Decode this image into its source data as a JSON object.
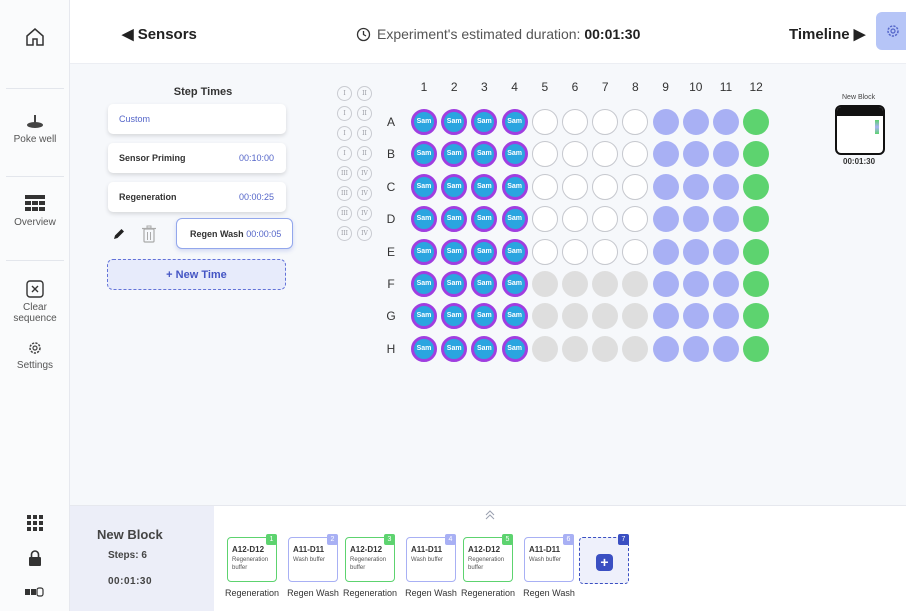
{
  "sidebar": {
    "poke_well": "Poke well",
    "overview": "Overview",
    "clear_sequence": "Clear sequence",
    "settings": "Settings"
  },
  "topbar": {
    "back_label": "◀ Sensors",
    "duration_label": "Experiment's estimated duration: ",
    "duration_value": "00:01:30",
    "next_label": "Timeline ▶"
  },
  "step_times": {
    "title": "Step Times",
    "items": [
      {
        "label": "Custom",
        "time": ""
      },
      {
        "label": "Sensor Priming",
        "time": "00:10:00"
      },
      {
        "label": "Regeneration",
        "time": "00:00:25"
      }
    ],
    "selected": {
      "label": "Regen Wash",
      "time": "00:00:05"
    },
    "new_time_label": "+ New Time"
  },
  "roman_rows": [
    [
      "I",
      "II"
    ],
    [
      "I",
      "II"
    ],
    [
      "I",
      "II"
    ],
    [
      "I",
      "II"
    ],
    [
      "III",
      "IV"
    ],
    [
      "III",
      "IV"
    ],
    [
      "III",
      "IV"
    ],
    [
      "III",
      "IV"
    ]
  ],
  "plate": {
    "columns": [
      "1",
      "2",
      "3",
      "4",
      "5",
      "6",
      "7",
      "8",
      "9",
      "10",
      "11",
      "12"
    ],
    "rows": [
      "A",
      "B",
      "C",
      "D",
      "E",
      "F",
      "G",
      "H"
    ],
    "sample_label": "Sam",
    "colors": {
      "sample": "#2aa5e0",
      "sample_ring": "#a03ee0",
      "lavender": "#a8b0f4",
      "green": "#5dd36f",
      "grey": "#dedede"
    }
  },
  "block_preview": {
    "label": "New Block",
    "time": "00:01:30"
  },
  "bottom": {
    "title": "New Block",
    "steps": "Steps: 6",
    "time": "00:01:30",
    "cards": [
      {
        "num": "1",
        "range": "A12-D12",
        "desc": "Regeneration buffer",
        "label": "Regeneration",
        "kind": "g"
      },
      {
        "num": "2",
        "range": "A11-D11",
        "desc": "Wash buffer",
        "label": "Regen Wash",
        "kind": "p"
      },
      {
        "num": "3",
        "range": "A12-D12",
        "desc": "Regeneration buffer",
        "label": "Regeneration",
        "kind": "g"
      },
      {
        "num": "4",
        "range": "A11-D11",
        "desc": "Wash buffer",
        "label": "Regen Wash",
        "kind": "p"
      },
      {
        "num": "5",
        "range": "A12-D12",
        "desc": "Regeneration buffer",
        "label": "Regeneration",
        "kind": "g"
      },
      {
        "num": "6",
        "range": "A11-D11",
        "desc": "Wash buffer",
        "label": "Regen Wash",
        "kind": "p"
      }
    ],
    "add_num": "7",
    "add_symbol": "+"
  }
}
